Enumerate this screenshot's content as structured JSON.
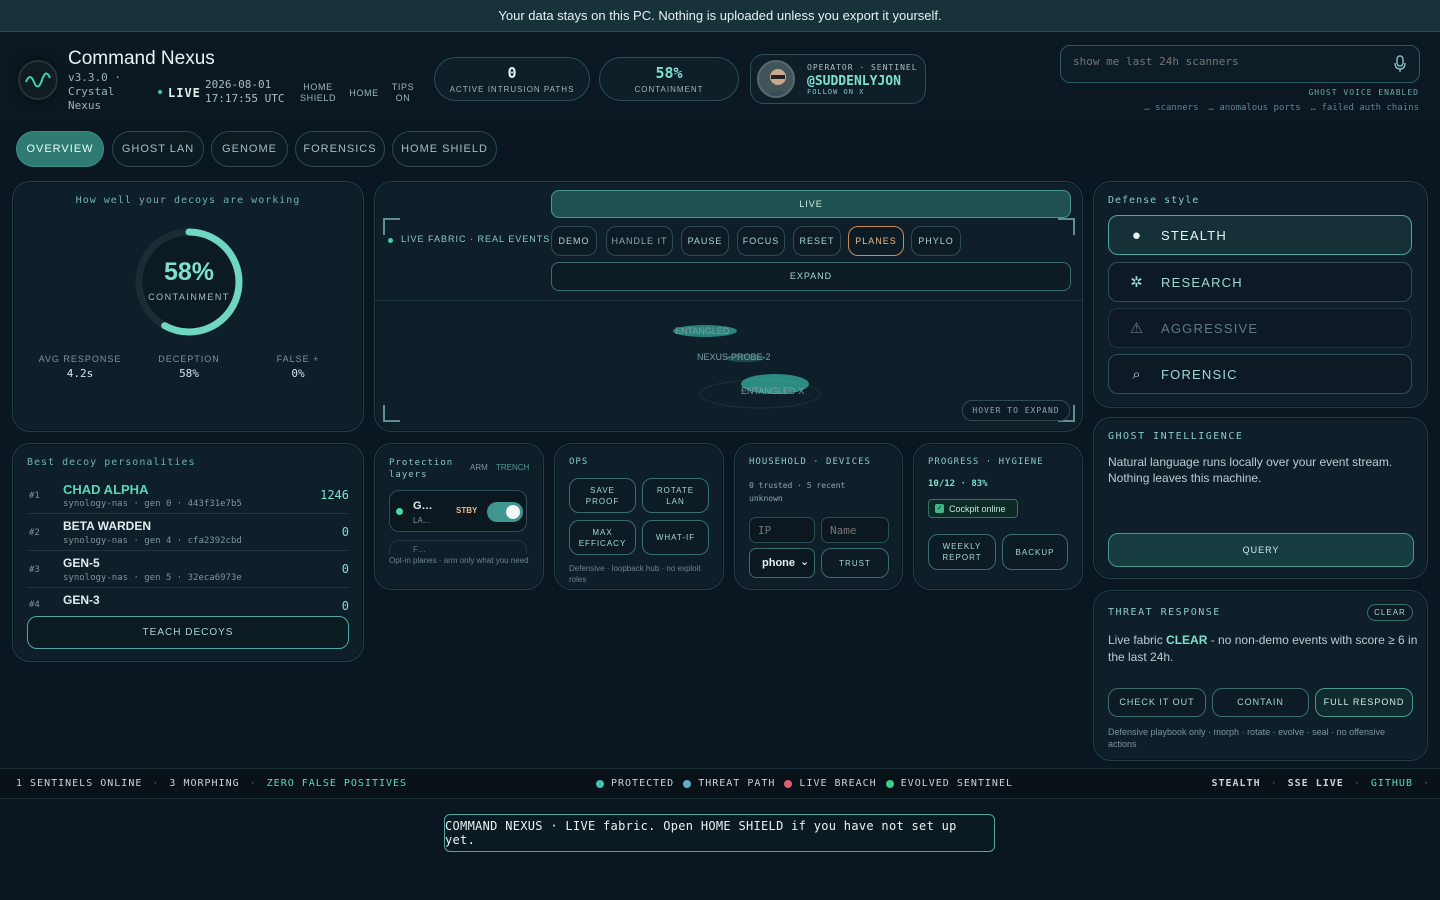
{
  "banner": "Your data stays on this PC. Nothing is uploaded unless you export it yourself.",
  "brand": {
    "title": "Command Nexus",
    "version": "v3.3.0 ·",
    "sub1": "Crystal",
    "sub2": "Nexus",
    "live": "LIVE",
    "date": "2026-08-01",
    "time": "17:17:55 UTC"
  },
  "header_links": [
    {
      "l1": "HOME",
      "l2": "SHIELD"
    },
    {
      "l1": "HOME",
      "l2": ""
    },
    {
      "l1": "TIPS",
      "l2": "ON"
    }
  ],
  "stats": {
    "paths_value": "0",
    "paths_label": "ACTIVE INTRUSION PATHS",
    "containment_value": "58%",
    "containment_label": "CONTAINMENT"
  },
  "operator": {
    "role": "OPERATOR · SENTINEL",
    "handle": "@SUDDENLYJON",
    "follow": "FOLLOW ON X"
  },
  "search": {
    "placeholder": "show me last 24h scanners",
    "voice": "GHOST VOICE ENABLED",
    "s1": "… scanners",
    "s2": "… anomalous ports",
    "s3": "… failed auth chains"
  },
  "tabs": [
    "OVERVIEW",
    "GHOST LAN",
    "GENOME",
    "FORENSICS",
    "HOME SHIELD"
  ],
  "decoy_gauge": {
    "title": "How well your decoys are working",
    "value": "58%",
    "label": "CONTAINMENT",
    "fraction": 0.58,
    "metrics": [
      {
        "label": "AVG RESPONSE",
        "value": "4.2s"
      },
      {
        "label": "DECEPTION",
        "value": "58%"
      },
      {
        "label": "FALSE +",
        "value": "0%"
      }
    ]
  },
  "fabric": {
    "live_btn": "LIVE",
    "title": "LIVE FABRIC · REAL EVENTS",
    "buttons": [
      "DEMO",
      "HANDLE IT",
      "PAUSE",
      "FOCUS",
      "RESET",
      "PLANES",
      "PHYLO"
    ],
    "expand": "EXPAND",
    "hover": "HOVER TO EXPAND",
    "nodes": [
      "ENTANGLED",
      "NEXUS-PROBE-2",
      "ENTANGLED-X"
    ]
  },
  "defense": {
    "title": "Defense style",
    "options": [
      "STEALTH",
      "RESEARCH",
      "AGGRESSIVE",
      "FORENSIC"
    ]
  },
  "ghost": {
    "title": "GHOST INTELLIGENCE",
    "text": "Natural language runs locally over your event stream. Nothing leaves this machine.",
    "query": "QUERY"
  },
  "decoys": {
    "title": "Best decoy personalities",
    "teach": "TEACH DECOYS",
    "rows": [
      {
        "rank": "#1",
        "name": "CHAD ALPHA",
        "meta": "synology-nas · gen 0 · 443f31e7b5",
        "score": "1246"
      },
      {
        "rank": "#2",
        "name": "BETA WARDEN",
        "meta": "synology-nas · gen 4 · cfa2392cbd",
        "score": "0"
      },
      {
        "rank": "#3",
        "name": "GEN-5",
        "meta": "synology-nas · gen 5 · 32eca6973e",
        "score": "0"
      },
      {
        "rank": "#4",
        "name": "GEN-3",
        "meta": "",
        "score": "0"
      }
    ]
  },
  "protection": {
    "title1": "Protection",
    "title2": "layers",
    "arm": "ARM",
    "trench": "TRENCH",
    "layer_name": "G…",
    "layer_sub": "LA…",
    "status": "STBY",
    "layer2": "F…",
    "foot": "Opt-in planes · arm only what you need"
  },
  "ops": {
    "title": "OPS",
    "buttons": [
      [
        "SAVE",
        "PROOF"
      ],
      [
        "ROTATE",
        "LAN"
      ],
      [
        "MAX",
        "EFFICACY"
      ],
      [
        "WHAT-IF",
        ""
      ]
    ],
    "foot": "Defensive · loopback hub · no exploit roles"
  },
  "household": {
    "title": "HOUSEHOLD · DEVICES",
    "line1": "0 trusted · 5 recent",
    "line2": "unknown",
    "ip_ph": "IP",
    "name_ph": "Name",
    "select": "phone",
    "trust": "TRUST"
  },
  "progress": {
    "title": "PROGRESS · HYGIENE",
    "value": "10/12 · 83%",
    "cockpit": "Cockpit online",
    "weekly1": "WEEKLY",
    "weekly2": "REPORT",
    "backup": "BACKUP"
  },
  "threat": {
    "title": "THREAT RESPONSE",
    "clear_btn": "CLEAR",
    "pre": "Live fabric ",
    "status": "CLEAR",
    "post": " - no non-demo events with score ≥ 6 in the last 24h.",
    "buttons": [
      "CHECK IT OUT",
      "CONTAIN",
      "FULL RESPOND"
    ],
    "foot": "Defensive playbook only · morph · rotate · evolve · seal · no offensive actions"
  },
  "footer": {
    "left": [
      "1 SENTINELS ONLINE",
      "3 MORPHING",
      "ZERO FALSE POSITIVES"
    ],
    "legend": [
      {
        "label": "PROTECTED",
        "color": "#3fc6b6"
      },
      {
        "label": "THREAT PATH",
        "color": "#5fb0c6"
      },
      {
        "label": "LIVE BREACH",
        "color": "#e0606e"
      },
      {
        "label": "EVOLVED SENTINEL",
        "color": "#3fd08c"
      }
    ],
    "right": [
      "STEALTH",
      "SSE LIVE",
      "GITHUB"
    ]
  },
  "toast": "COMMAND NEXUS · LIVE fabric. Open HOME SHIELD if you have not set up yet."
}
